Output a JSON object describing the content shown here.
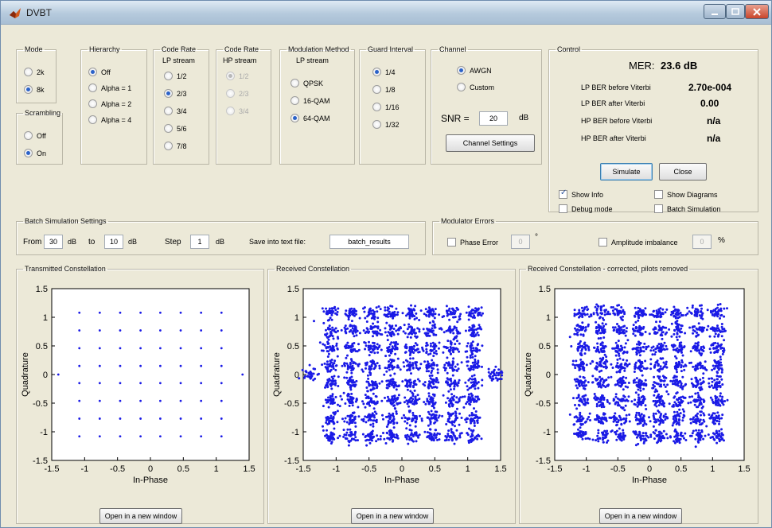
{
  "window": {
    "title": "DVBT"
  },
  "mode": {
    "legend": "Mode",
    "options": [
      "2k",
      "8k"
    ],
    "selected": 1
  },
  "scrambling": {
    "legend": "Scrambling",
    "options": [
      "Off",
      "On"
    ],
    "selected": 1
  },
  "hierarchy": {
    "legend": "Hierarchy",
    "options": [
      "Off",
      "Alpha = 1",
      "Alpha = 2",
      "Alpha = 4"
    ],
    "selected": 0
  },
  "code_rate_lp": {
    "legend": "Code Rate",
    "sublabel": "LP stream",
    "options": [
      "1/2",
      "2/3",
      "3/4",
      "5/6",
      "7/8"
    ],
    "selected": 1
  },
  "code_rate_hp": {
    "legend": "Code Rate",
    "sublabel": "HP stream",
    "options": [
      "1/2",
      "2/3",
      "3/4"
    ],
    "selected": 0,
    "enabled": false
  },
  "modulation": {
    "legend": "Modulation Method",
    "sublabel": "LP stream",
    "options": [
      "QPSK",
      "16-QAM",
      "64-QAM"
    ],
    "selected": 2
  },
  "guard_interval": {
    "legend": "Guard Interval",
    "options": [
      "1/4",
      "1/8",
      "1/16",
      "1/32"
    ],
    "selected": 0
  },
  "channel": {
    "legend": "Channel",
    "options": [
      "AWGN",
      "Custom"
    ],
    "selected": 0,
    "snr_label": "SNR =",
    "snr_value": "20",
    "snr_unit": "dB",
    "settings_button": "Channel Settings"
  },
  "control": {
    "legend": "Control",
    "mer_label": "MER:",
    "mer_value": "23.6 dB",
    "rows": [
      {
        "label": "LP BER before Viterbi",
        "value": "2.70e-004"
      },
      {
        "label": "LP BER after Viterbi",
        "value": "0.00"
      },
      {
        "label": "HP BER before Viterbi",
        "value": "n/a"
      },
      {
        "label": "HP BER after Viterbi",
        "value": "n/a"
      }
    ],
    "simulate_button": "Simulate",
    "close_button": "Close",
    "show_info": {
      "label": "Show Info",
      "checked": true
    },
    "show_diagrams": {
      "label": "Show Diagrams",
      "checked": false
    },
    "debug_mode": {
      "label": "Debug mode",
      "checked": false
    },
    "batch_simulation": {
      "label": "Batch Simulation",
      "checked": false
    }
  },
  "batch": {
    "legend": "Batch Simulation Settings",
    "from_label": "From",
    "from_value": "30",
    "db1": "dB",
    "to_label": "to",
    "to_value": "10",
    "db2": "dB",
    "step_label": "Step",
    "step_value": "1",
    "db3": "dB",
    "save_label": "Save into text file:",
    "file_value": "batch_results"
  },
  "modulator_errors": {
    "legend": "Modulator Errors",
    "phase_label": "Phase Error",
    "phase_value": "0",
    "phase_unit": "°",
    "amp_label": "Amplitude imbalance",
    "amp_value": "0",
    "amp_unit": "%"
  },
  "plots": [
    {
      "legend": "Transmitted Constellation",
      "button": "Open in a new window"
    },
    {
      "legend": "Received Constellation",
      "button": "Open in a new window"
    },
    {
      "legend": "Received Constellation - corrected, pilots removed",
      "button": "Open in a new window"
    }
  ],
  "colors": {
    "point": "#1a1ae6",
    "window_bg": "#ece9d8",
    "default_button_border": "#3c7fb1"
  },
  "chart_data": [
    {
      "type": "scatter",
      "title": "",
      "xlabel": "In-Phase",
      "ylabel": "Quadrature",
      "xlim": [
        -1.5,
        1.5
      ],
      "ylim": [
        -1.5,
        1.5
      ],
      "xticks": [
        "-1.5",
        "-1",
        "-0.5",
        "0",
        "0.5",
        "1",
        "1.5"
      ],
      "yticks": [
        "1.5",
        "1",
        "0.5",
        "0",
        "-0.5",
        "-1",
        "-1.5"
      ],
      "grid_levels": [
        -1.08,
        -0.77,
        -0.46,
        -0.15,
        0.15,
        0.46,
        0.77,
        1.08
      ],
      "extra_points": [
        [
          -1.4,
          0
        ],
        [
          1.4,
          0
        ]
      ],
      "spread": 0,
      "marker": "dot"
    },
    {
      "type": "scatter",
      "title": "",
      "xlabel": "In-Phase",
      "ylabel": "Quadrature",
      "xlim": [
        -1.5,
        1.5
      ],
      "ylim": [
        -1.5,
        1.5
      ],
      "xticks": [
        "-1.5",
        "-1",
        "-0.5",
        "0",
        "0.5",
        "1",
        "1.5"
      ],
      "yticks": [
        "1.5",
        "1",
        "0.5",
        "0",
        "-0.5",
        "-1",
        "-1.5"
      ],
      "grid_levels": [
        -1.08,
        -0.77,
        -0.46,
        -0.15,
        0.15,
        0.46,
        0.77,
        1.08
      ],
      "extra_points": [
        [
          -1.4,
          0
        ],
        [
          1.4,
          0
        ]
      ],
      "spread": 0.06,
      "marker": "cluster"
    },
    {
      "type": "scatter",
      "title": "",
      "xlabel": "In-Phase",
      "ylabel": "Quadrature",
      "xlim": [
        -1.5,
        1.5
      ],
      "ylim": [
        -1.5,
        1.5
      ],
      "xticks": [
        "-1.5",
        "-1",
        "-0.5",
        "0",
        "0.5",
        "1",
        "1.5"
      ],
      "yticks": [
        "1.5",
        "1",
        "0.5",
        "0",
        "-0.5",
        "-1",
        "-1.5"
      ],
      "grid_levels": [
        -1.08,
        -0.77,
        -0.46,
        -0.15,
        0.15,
        0.46,
        0.77,
        1.08
      ],
      "extra_points": [],
      "spread": 0.06,
      "marker": "cluster"
    }
  ]
}
